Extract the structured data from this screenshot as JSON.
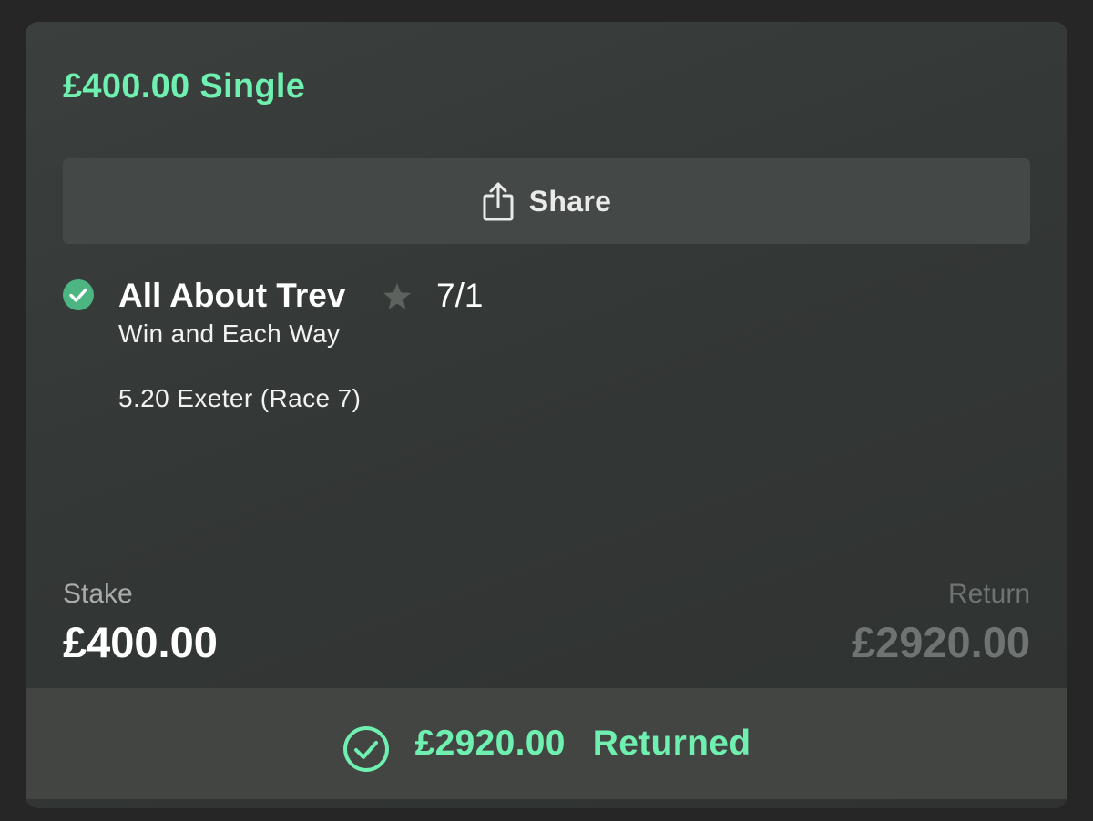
{
  "bet": {
    "title": "£400.00 Single",
    "share_label": "Share",
    "selection": {
      "name": "All About Trev",
      "odds": "7/1",
      "market": "Win and Each Way",
      "event": "5.20 Exeter (Race 7)",
      "status_icon": "check-circle-icon",
      "favourite_icon": "star-icon"
    },
    "stake_label": "Stake",
    "stake_value": "£400.00",
    "return_label": "Return",
    "return_value": "£2920.00",
    "returned_amount": "£2920.00",
    "returned_label": "Returned"
  },
  "colors": {
    "accent": "#6ff0b0",
    "check_fill": "#4cb582",
    "muted": "#6f7371"
  }
}
